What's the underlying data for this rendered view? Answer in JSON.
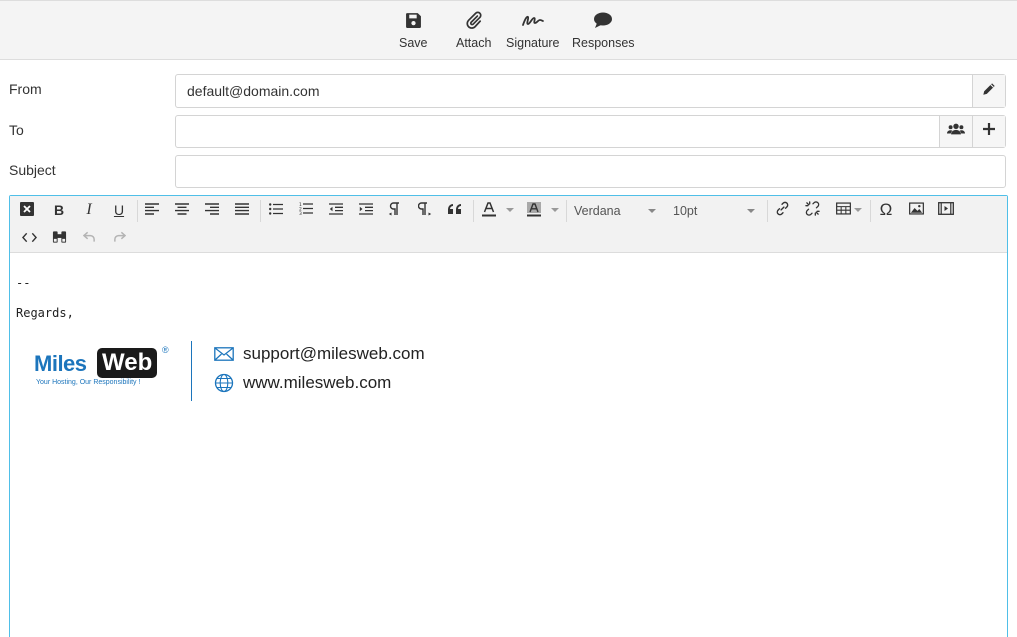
{
  "toolbar": {
    "save_label": "Save",
    "attach_label": "Attach",
    "signature_label": "Signature",
    "responses_label": "Responses"
  },
  "form": {
    "from_label": "From",
    "from_value": "default@domain.com",
    "to_label": "To",
    "to_value": "",
    "subject_label": "Subject",
    "subject_value": ""
  },
  "editor": {
    "font_family": "Verdana",
    "font_size": "10pt",
    "body_lines": [
      "--",
      "Regards,"
    ],
    "signature": {
      "brand_left": "Miles",
      "brand_right": "Web",
      "brand_mark": "®",
      "tagline": "Your Hosting, Our Responsibility !",
      "email": "support@milesweb.com",
      "website": "www.milesweb.com"
    }
  },
  "colors": {
    "accent_border": "#4fbfe8",
    "brand_blue": "#1c75bc",
    "brand_dark": "#1a1a1a"
  }
}
